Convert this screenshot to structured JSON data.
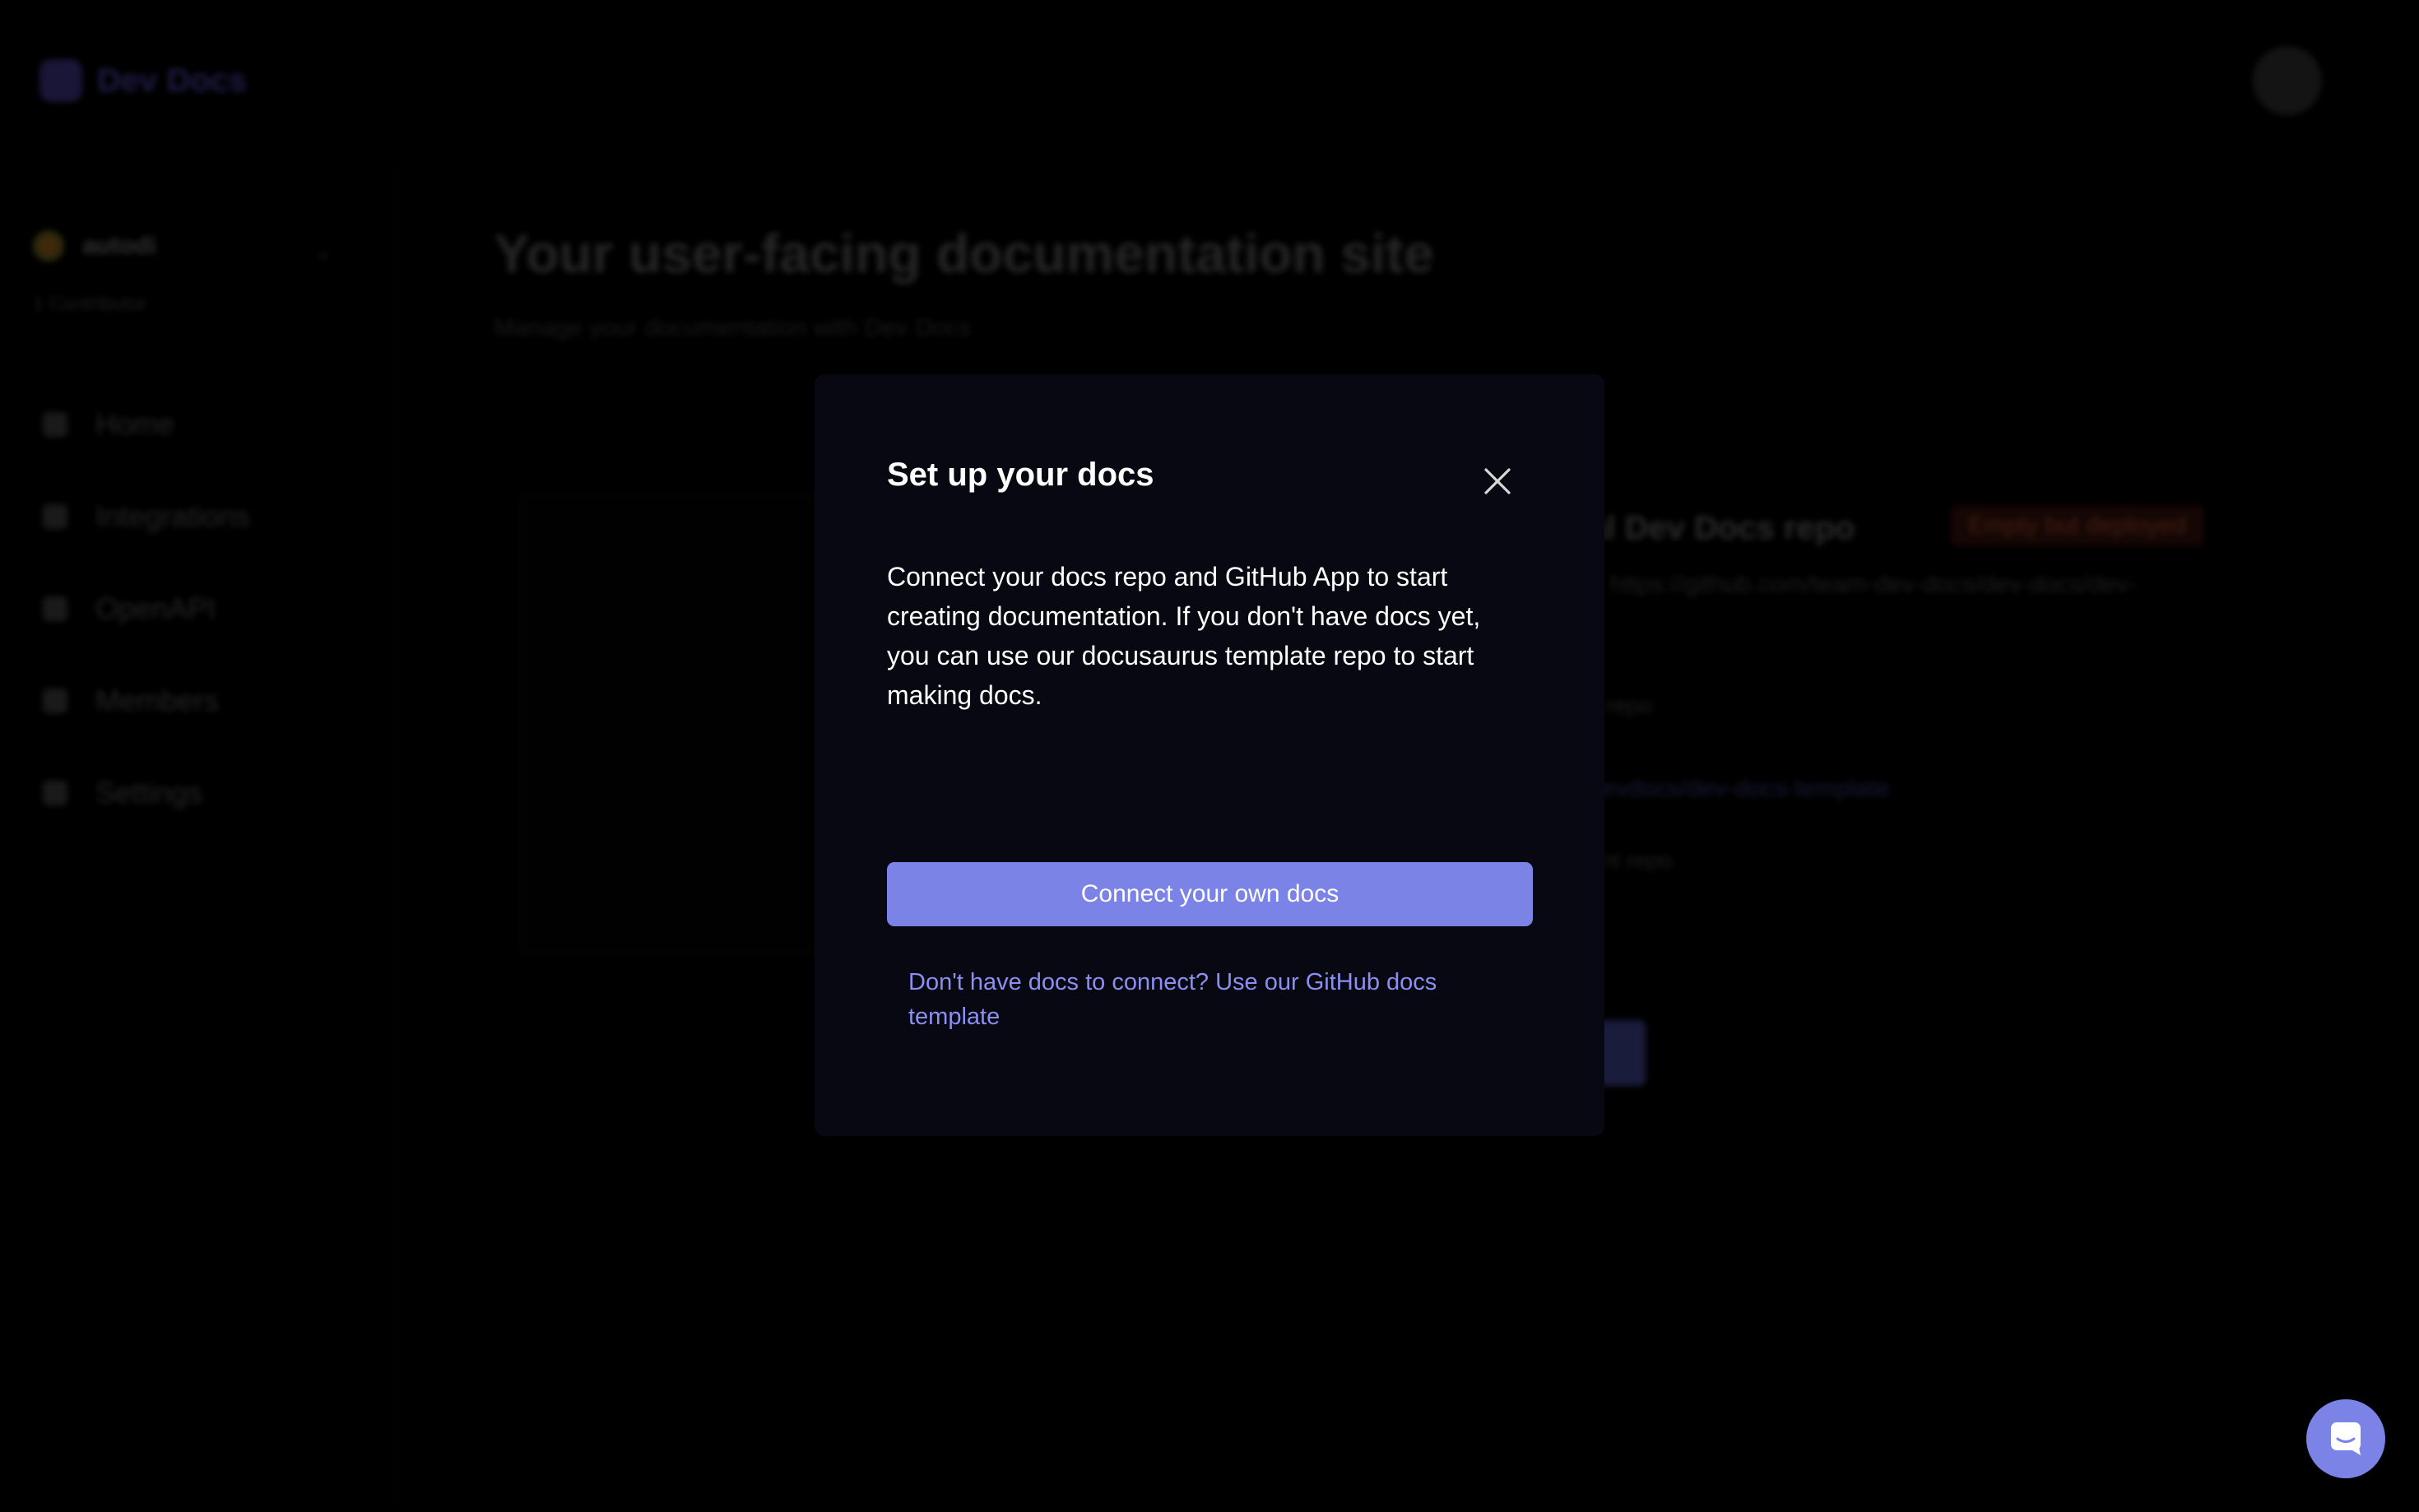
{
  "app": {
    "logo_text": "Dev Docs",
    "workspace": {
      "name": "autodi",
      "subtitle": "1 Contributor"
    },
    "nav": [
      {
        "label": "Home",
        "icon": "home-icon"
      },
      {
        "label": "Integrations",
        "icon": "puzzle-icon"
      },
      {
        "label": "OpenAPI",
        "icon": "document-icon"
      },
      {
        "label": "Members",
        "icon": "users-icon"
      },
      {
        "label": "Settings",
        "icon": "gear-icon"
      }
    ],
    "main": {
      "title": "Your user-facing documentation site",
      "subtitle": "Manage your documentation with Dev Docs",
      "card": {
        "heading": "al Dev Docs repo",
        "badge": "Empty but deployed",
        "line1": "r: https://github.com/team-dev-docs/dev-docs/dev-",
        "line2": "it repo",
        "line3": "devdocs/dev-docs-template",
        "line4": "ent repo"
      }
    }
  },
  "modal": {
    "title": "Set up your docs",
    "body": "Connect your docs repo and GitHub App to start creating documentation. If you don't have docs yet, you can use our docusaurus template repo to start making docs.",
    "primary_button": "Connect your own docs",
    "secondary_link": "Don't have docs to connect? Use our GitHub docs template",
    "close_icon": "close-icon"
  },
  "chat": {
    "icon": "chat-icon"
  },
  "colors": {
    "accent": "#7b83e6",
    "link": "#8b8ff0",
    "modal_bg": "#070811",
    "page_bg": "#000000"
  }
}
